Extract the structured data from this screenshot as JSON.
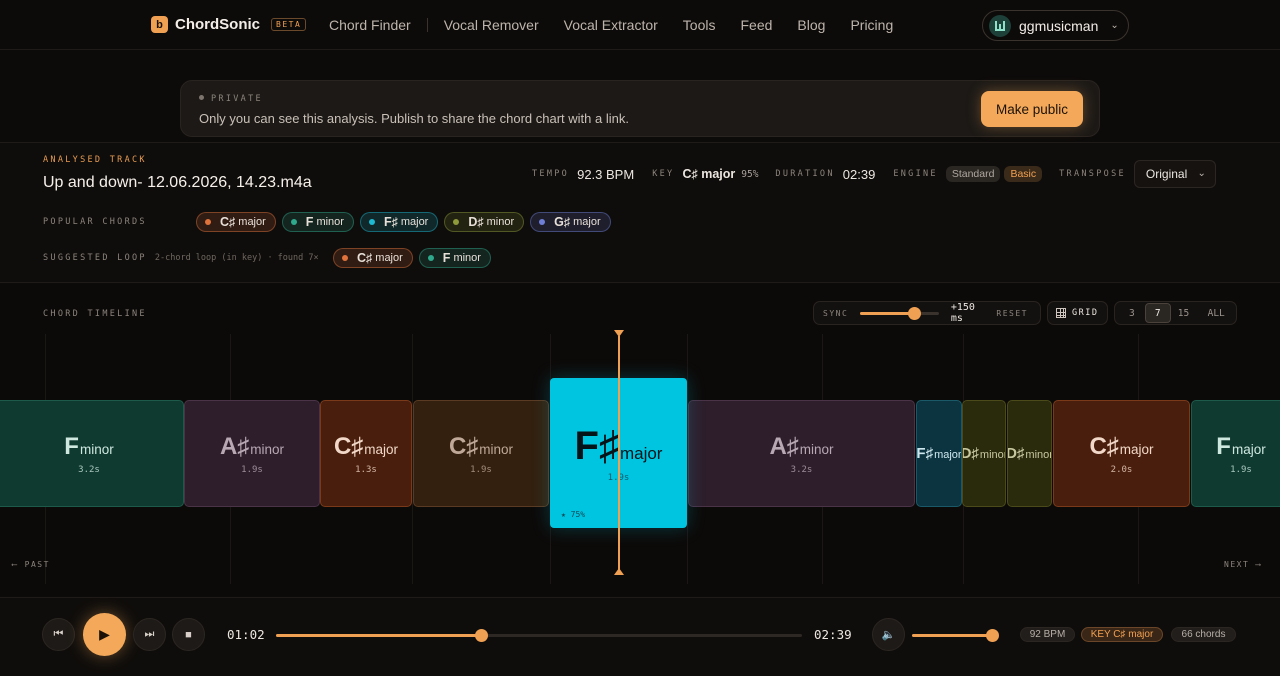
{
  "nav": {
    "logo_glyph": "b",
    "brand": "ChordSonic",
    "badge": "BETA",
    "links": [
      "Chord Finder",
      "Vocal Remover",
      "Vocal Extractor",
      "Tools",
      "Feed",
      "Blog",
      "Pricing"
    ],
    "user": "ggmusicman",
    "user_caret": "⌄"
  },
  "banner": {
    "status": "PRIVATE",
    "text": "Only you can see this analysis. Publish to share the chord chart with a link.",
    "button": "Make public"
  },
  "analysis": {
    "label": "ANALYSED TRACK",
    "track": "Up and down- 12.06.2026, 14.23.m4a",
    "tempo_label": "TEMPO",
    "tempo": "92.3 BPM",
    "key_label": "KEY",
    "key": "C♯ major",
    "key_confidence": "95%",
    "duration_label": "DURATION",
    "duration": "02:39",
    "engine_label": "ENGINE",
    "engines": [
      "Standard",
      "Basic"
    ],
    "engine_selected": "Basic",
    "transpose_label": "TRANSPOSE",
    "transpose": "Original",
    "transpose_caret": "⌄",
    "popular_label": "POPULAR CHORDS",
    "popular": [
      {
        "root": "C♯",
        "quality": "major",
        "color": "#e0733c"
      },
      {
        "root": "F",
        "quality": "minor",
        "color": "#2fa98c"
      },
      {
        "root": "F♯",
        "quality": "major",
        "color": "#1db8d2"
      },
      {
        "root": "D♯",
        "quality": "minor",
        "color": "#8f9a3a"
      },
      {
        "root": "G♯",
        "quality": "major",
        "color": "#6f7fd8"
      }
    ],
    "loop_label": "SUGGESTED LOOP",
    "loop_info": "2-chord loop (in key) · found 7×",
    "loop": [
      {
        "root": "C♯",
        "quality": "major",
        "color": "#e0733c"
      },
      {
        "root": "F",
        "quality": "minor",
        "color": "#2fa98c"
      }
    ]
  },
  "timeline": {
    "label": "CHORD TIMELINE",
    "sync_label": "SYNC",
    "sync_offset": "+150 ms",
    "sync_fraction": 0.62,
    "reset": "RESET",
    "grid": "GRID",
    "windows": [
      "3",
      "7",
      "15",
      "ALL"
    ],
    "window_selected": "7",
    "past": "⟵ PAST",
    "next": "NEXT ⟶",
    "blocks": [
      {
        "root": "F",
        "quality": "minor",
        "dur": "3.2s",
        "bg": "#0f3a30",
        "border": "#1d5a4a",
        "fg": "#cfe8df"
      },
      {
        "root": "A♯",
        "quality": "minor",
        "dur": "1.9s",
        "bg": "#2e1e2c",
        "border": "#4a3247",
        "fg": "#b8a8b4"
      },
      {
        "root": "C♯",
        "quality": "major",
        "dur": "1.3s",
        "bg": "#4a1e0c",
        "border": "#7a3a1a",
        "fg": "#f1d8c8"
      },
      {
        "root": "C♯",
        "quality": "minor",
        "dur": "1.9s",
        "bg": "#33200f",
        "border": "#5a3a22",
        "fg": "#bfa898"
      },
      {
        "root": "A♯",
        "quality": "minor",
        "dur": "3.2s",
        "bg": "#2e1e2c",
        "border": "#4a3247",
        "fg": "#b8a8b4"
      },
      {
        "root": "F♯",
        "quality": "major",
        "dur": "",
        "bg": "#0c3440",
        "border": "#1a5a68",
        "fg": "#cfe8ef"
      },
      {
        "root": "D♯",
        "quality": "minor",
        "dur": "",
        "bg": "#2a2a0c",
        "border": "#4a4a1a",
        "fg": "#c8c8a0"
      },
      {
        "root": "D♯",
        "quality": "minor",
        "dur": "",
        "bg": "#2a2a0c",
        "border": "#4a4a1a",
        "fg": "#c8c8a0"
      },
      {
        "root": "C♯",
        "quality": "major",
        "dur": "2.0s",
        "bg": "#4a1e0c",
        "border": "#7a3a1a",
        "fg": "#f1d8c8"
      },
      {
        "root": "F",
        "quality": "major",
        "dur": "1.9s",
        "bg": "#0f3a30",
        "border": "#1d5a4a",
        "fg": "#cfe8df"
      }
    ],
    "active": {
      "root": "F♯",
      "quality": "major",
      "dur": "1.9s",
      "confidence": "★ 75%"
    }
  },
  "player": {
    "prev_icon": "⏮",
    "play_icon": "▶",
    "next_icon": "⏭",
    "stop_icon": "■",
    "volume_icon": "🔈",
    "current": "01:02",
    "total": "02:39",
    "progress_fraction": 0.39,
    "volume_fraction": 1.0,
    "bpm": "92 BPM",
    "key": "KEY C♯ major",
    "chords": "66 chords"
  }
}
